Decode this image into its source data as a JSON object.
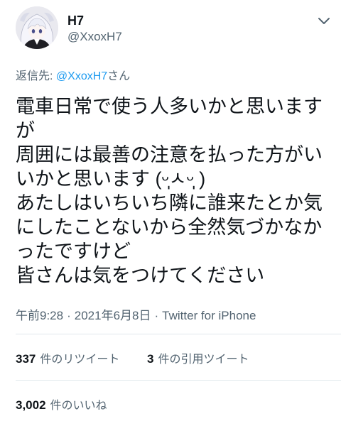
{
  "author": {
    "display_name": "H7",
    "handle": "@XxoxH7"
  },
  "reply_context": {
    "prefix": "返信先: ",
    "mention": "@XxoxH7",
    "suffix": "さん"
  },
  "tweet": {
    "lines": [
      "電車日常で使う人多いかと思います",
      "が",
      "周囲には最善の注意を払った方がい",
      "いかと思います (ᵕ̩̩ㅅᵕ̩̩ )",
      "あたしはいちいち隣に誰来たとか気",
      "にしたことないから全然気づかなか",
      "ったですけど",
      "皆さんは気をつけてください"
    ]
  },
  "meta": {
    "time": "午前9:28",
    "separator": "·",
    "date": "2021年6月8日",
    "source": "Twitter for iPhone"
  },
  "stats": {
    "retweets": {
      "count": "337",
      "label": "件のリツイート"
    },
    "quotes": {
      "count": "3",
      "label": "件の引用ツイート"
    },
    "likes": {
      "count": "3,002",
      "label": "件のいいね"
    }
  },
  "icons": {
    "avatar": "avatar-image",
    "more": "chevron-down-icon"
  },
  "colors": {
    "background": "#ffffff",
    "text": "#0f1419",
    "secondary": "#536471",
    "link": "#1d9bf0",
    "divider": "#e1e8ed"
  }
}
